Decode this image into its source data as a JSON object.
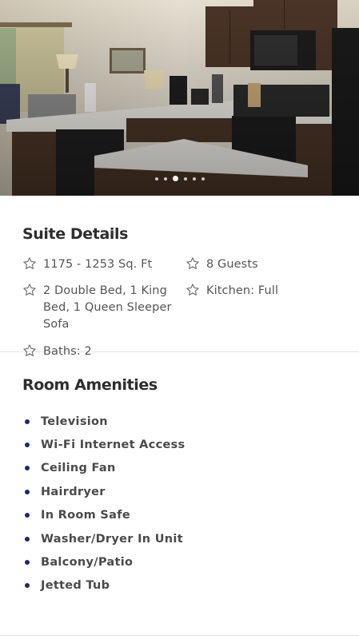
{
  "hero": {
    "image": "kitchen-photo",
    "carousel": {
      "total": 6,
      "active_index": 2
    }
  },
  "suite_details": {
    "title": "Suite Details",
    "icon": "star-outline-icon",
    "items": [
      {
        "text": "1175 - 1253 Sq. Ft"
      },
      {
        "text": "8 Guests"
      },
      {
        "text": "2 Double Bed, 1 King Bed, 1 Queen Sleeper Sofa"
      },
      {
        "text": "Kitchen: Full"
      },
      {
        "text": "Baths: 2"
      }
    ]
  },
  "amenities": {
    "title": "Room Amenities",
    "bullet_color": "#1c2a66",
    "items": [
      "Television",
      "Wi-Fi Internet Access",
      "Ceiling Fan",
      "Hairdryer",
      "In Room Safe",
      "Washer/Dryer In Unit",
      "Balcony/Patio",
      "Jetted Tub"
    ]
  }
}
